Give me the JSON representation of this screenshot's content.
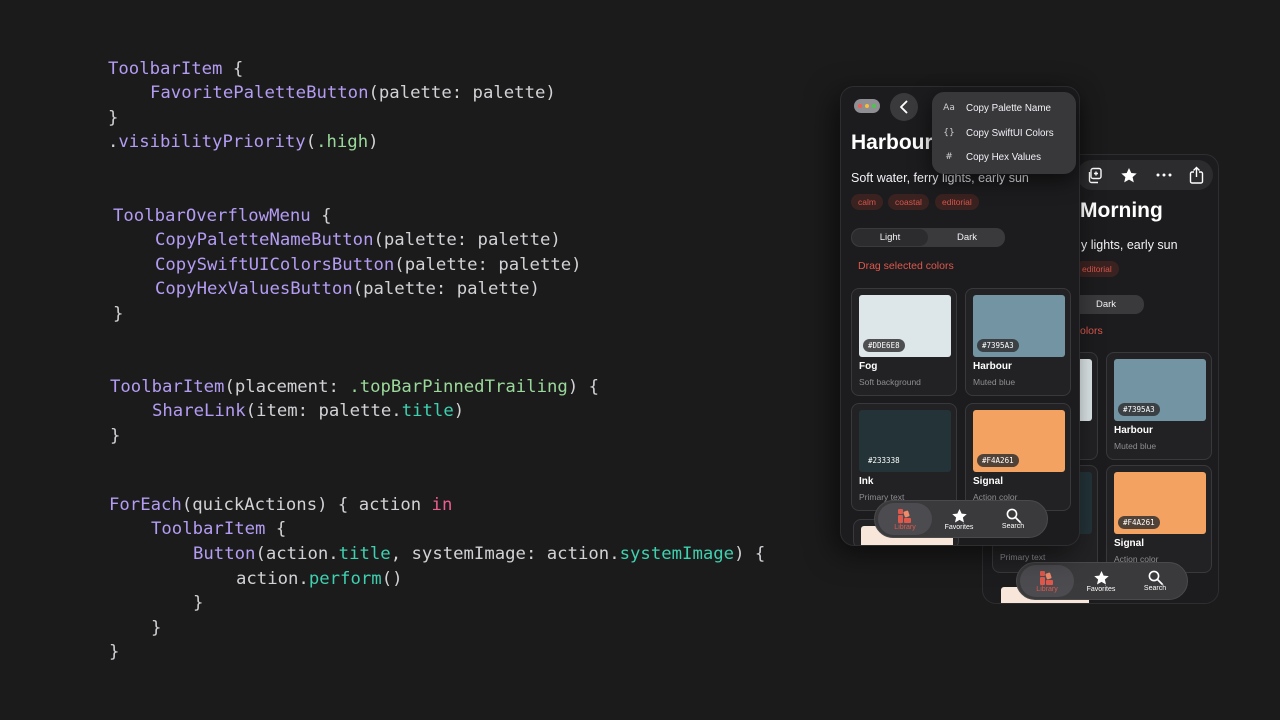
{
  "code": {
    "block1": {
      "l1_kw": "ToolbarItem",
      "l1_rest": " {",
      "l2_fn": "FavoritePaletteButton",
      "l2_rest": "(palette: palette)",
      "l3": "}",
      "l4_dot": ".",
      "l4_fn": "visibilityPriority",
      "l4_open": "(",
      "l4_arg": ".high",
      "l4_close": ")"
    },
    "block2": {
      "l1_kw": "ToolbarOverflowMenu",
      "l1_rest": " {",
      "l2_fn": "CopyPaletteNameButton",
      "l2_rest": "(palette: palette)",
      "l3_fn": "CopySwiftUIColorsButton",
      "l3_rest": "(palette: palette)",
      "l4_fn": "CopyHexValuesButton",
      "l4_rest": "(palette: palette)",
      "l5": "}"
    },
    "block3": {
      "l1_kw": "ToolbarItem",
      "l1_mid": "(placement: ",
      "l1_arg": ".topBarPinnedTrailing",
      "l1_rest": ") {",
      "l2_fn": "ShareLink",
      "l2_mid": "(item: palette.",
      "l2_prop": "title",
      "l2_rest": ")",
      "l3": "}"
    },
    "block4": {
      "l1_kw": "ForEach",
      "l1_mid": "(quickActions) { action ",
      "l1_in": "in",
      "l2_kw": "ToolbarItem",
      "l2_rest": " {",
      "l3_fn": "Button",
      "l3_a": "(action.",
      "l3_p1": "title",
      "l3_b": ", systemImage: action.",
      "l3_p2": "systemImage",
      "l3_c": ") {",
      "l4_a": "action.",
      "l4_fn": "perform",
      "l4_b": "()",
      "l5": "}",
      "l6": "}",
      "l7": "}"
    }
  },
  "front_phone": {
    "title": "Harbour",
    "subtitle": "Soft water, ferry lights, early sun",
    "tags": [
      "calm",
      "coastal",
      "editorial"
    ],
    "segment": [
      "Light",
      "Dark"
    ],
    "drag_label": "Drag selected colors",
    "menu_items": [
      {
        "icon": "Aa",
        "label": "Copy Palette Name"
      },
      {
        "icon": "{}",
        "label": "Copy SwiftUI Colors"
      },
      {
        "icon": "#",
        "label": "Copy Hex Values"
      }
    ],
    "cards": [
      {
        "hex": "#DDE6E8",
        "name": "Fog",
        "desc": "Soft background",
        "color": "#dde6e8"
      },
      {
        "hex": "#7395A3",
        "name": "Harbour",
        "desc": "Muted blue",
        "color": "#7395a3"
      },
      {
        "hex": "#233338",
        "name": "Ink",
        "desc": "Primary text",
        "color": "#233338"
      },
      {
        "hex": "#F4A261",
        "name": "Signal",
        "desc": "Action color",
        "color": "#f4a261"
      }
    ]
  },
  "back_phone": {
    "title": "Morning",
    "subtitle": "y lights, early sun",
    "tag": "editorial",
    "segment_dark": "Dark",
    "drag_partial": "olors",
    "cards": [
      {
        "hex": "#7395A3",
        "name": "Harbour",
        "desc": "Muted blue",
        "color": "#7395a3"
      },
      {
        "hex": "#F4A261",
        "name": "Signal",
        "desc": "Action color",
        "color": "#f4a261"
      }
    ],
    "left_card_desc": "Primary text"
  },
  "tabbar": {
    "items": [
      "Library",
      "Favorites",
      "Search"
    ]
  },
  "colors": {
    "accent": "#e0584c",
    "background": "#1b1b1c",
    "keyword": "#b49cf3",
    "literal": "#9ad89a",
    "property": "#3fd0b0"
  }
}
